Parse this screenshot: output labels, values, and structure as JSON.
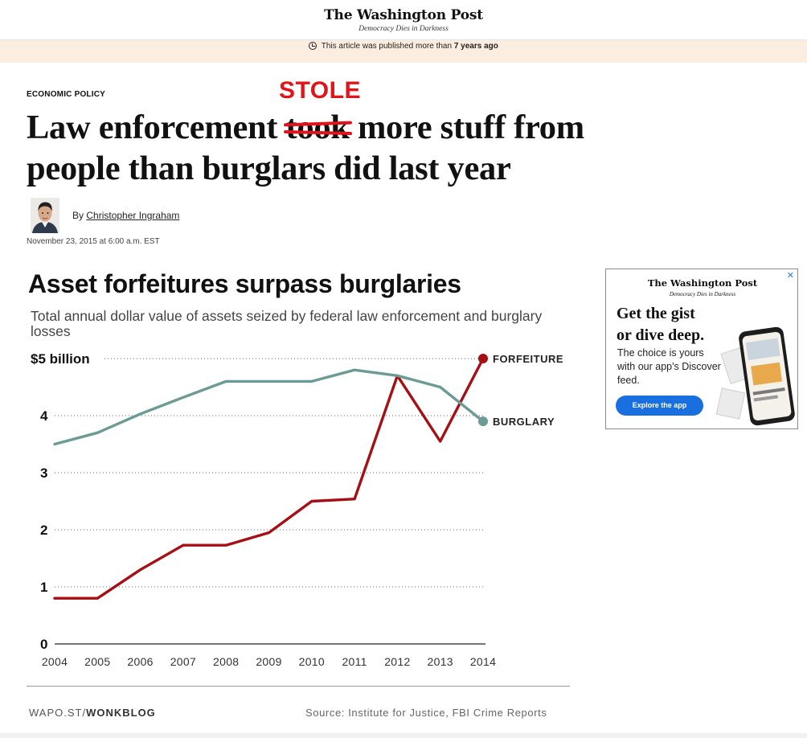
{
  "masthead": {
    "logo": "The Washington Post",
    "tagline": "Democracy Dies in Darkness"
  },
  "notice": {
    "prefix": "This article was published more than",
    "emphasis": "7 years ago"
  },
  "article": {
    "section": "ECONOMIC POLICY",
    "annotation": "STOLE",
    "headline_before": "Law enforcement ",
    "headline_struck": "took",
    "headline_after": " more stuff from people than burglars did last year",
    "byline_prefix": "By",
    "author": "Christopher Ingraham",
    "date": "November 23, 2015 at 6:00 a.m. EST"
  },
  "chart_data": {
    "type": "line",
    "title": "Asset forfeitures surpass burglaries",
    "subtitle": "Total annual dollar value of assets seized by federal law enforcement and burglary losses",
    "x": [
      2004,
      2005,
      2006,
      2007,
      2008,
      2009,
      2010,
      2011,
      2012,
      2013,
      2014
    ],
    "series": [
      {
        "name": "FORFEITURE",
        "color": "#a50f15",
        "values": [
          0.8,
          0.8,
          1.3,
          1.73,
          1.73,
          1.95,
          2.5,
          2.54,
          4.7,
          3.55,
          5.0
        ]
      },
      {
        "name": "BURGLARY",
        "color": "#6b9b94",
        "values": [
          3.5,
          3.7,
          4.03,
          4.32,
          4.6,
          4.6,
          4.6,
          4.8,
          4.7,
          4.5,
          3.9
        ]
      }
    ],
    "y_ticks": [
      "0",
      "1",
      "2",
      "3",
      "4",
      "$5 billion"
    ],
    "ylim": [
      0,
      5
    ],
    "grid": "dotted horizontal",
    "legend": "direct labels at line ends",
    "credit_prefix": "WAPO.ST/",
    "credit_bold": "WONKBLOG",
    "source": "Source: Institute for Justice, FBI Crime Reports"
  },
  "ad": {
    "logo": "The Washington Post",
    "tagline": "Democracy Dies in Darkness",
    "headline_line1": "Get the gist",
    "headline_line2": "or dive deep.",
    "body": "The choice is yours with our app's Discover feed.",
    "button": "Explore the app",
    "close": "✕"
  }
}
